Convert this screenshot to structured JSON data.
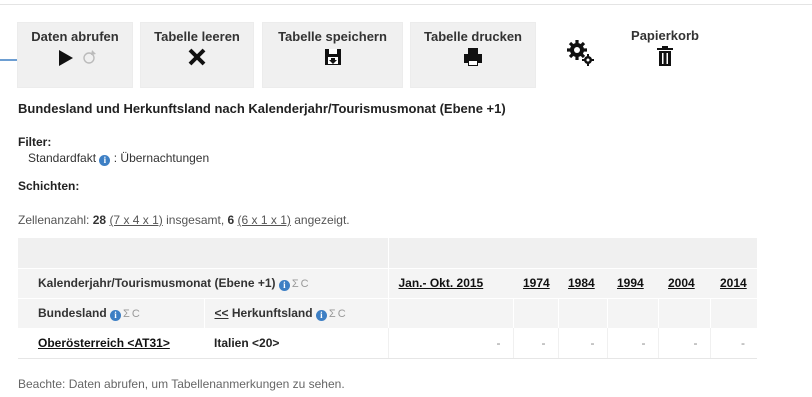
{
  "toolbar": {
    "fetch_label": "Daten abrufen",
    "clear_label": "Tabelle leeren",
    "save_label": "Tabelle speichern",
    "print_label": "Tabelle drucken",
    "trash_label": "Papierkorb"
  },
  "heading": "Bundesland und Herkunftsland nach Kalenderjahr/Tourismusmonat (Ebene +1)",
  "filter": {
    "title": "Filter:",
    "fact_label": "Standardfakt",
    "fact_value": ": Übernachtungen"
  },
  "layers_title": "Schichten:",
  "cellcount": {
    "prefix": "Zellenanzahl:",
    "total": "28",
    "total_dims": "(7 x 4 x 1)",
    "mid": "insgesamt,",
    "shown": "6",
    "shown_dims": "(6 x 1 x 1)",
    "suffix": "angezeigt."
  },
  "table": {
    "column_dim_label": "Kalenderjahr/Tourismusmonat (Ebene +1)",
    "row_dim1_label": "Bundesland",
    "row_dim2_prefix": "<<",
    "row_dim2_label": "Herkunftsland",
    "columns": [
      "Jan.- Okt. 2015",
      "1974",
      "1984",
      "1994",
      "2004",
      "2014"
    ],
    "row_label": "Oberösterreich <AT31>",
    "row_sub_label": "Italien <20>",
    "values": [
      "-",
      "-",
      "-",
      "-",
      "-",
      "-"
    ]
  },
  "note": "Beachte: Daten abrufen, um Tabellenanmerkungen zu sehen."
}
